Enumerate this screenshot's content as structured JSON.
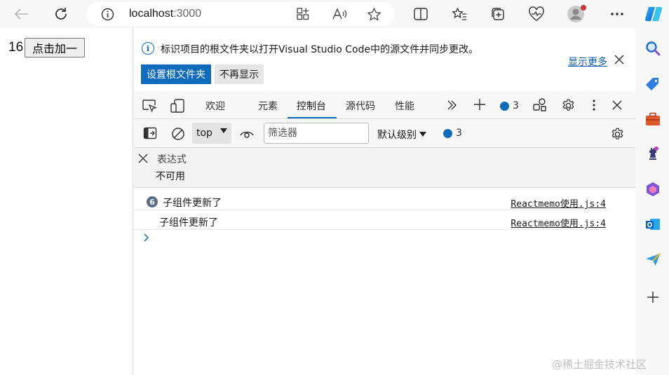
{
  "browser": {
    "url_host": "localhost",
    "url_port": ":3000"
  },
  "page": {
    "count": "16",
    "button_label": "点击加一"
  },
  "infobar": {
    "message": "标识项目的根文件夹以打开Visual Studio Code中的源文件并同步更改。",
    "show_more": "显示更多",
    "primary_button": "设置根文件夹",
    "secondary_button": "不再显示"
  },
  "tabs": [
    {
      "label": "欢迎"
    },
    {
      "label": "元素"
    },
    {
      "label": "控制台"
    },
    {
      "label": "源代码"
    },
    {
      "label": "性能"
    }
  ],
  "tab_badge_count": "3",
  "toolbar": {
    "context": "top",
    "filter_placeholder": "筛选器",
    "levels": "默认级别",
    "issues_count": "3"
  },
  "expression": {
    "label": "表达式",
    "value": "不可用"
  },
  "logs": [
    {
      "count": "6",
      "message": "子组件更新了",
      "source": "Reactmemo使用.js:4"
    },
    {
      "count": "",
      "message": "子组件更新了",
      "source": "Reactmemo使用.js:4"
    }
  ],
  "watermark": "@稀土掘金技术社区",
  "colors": {
    "accent": "#0f6cbd"
  }
}
